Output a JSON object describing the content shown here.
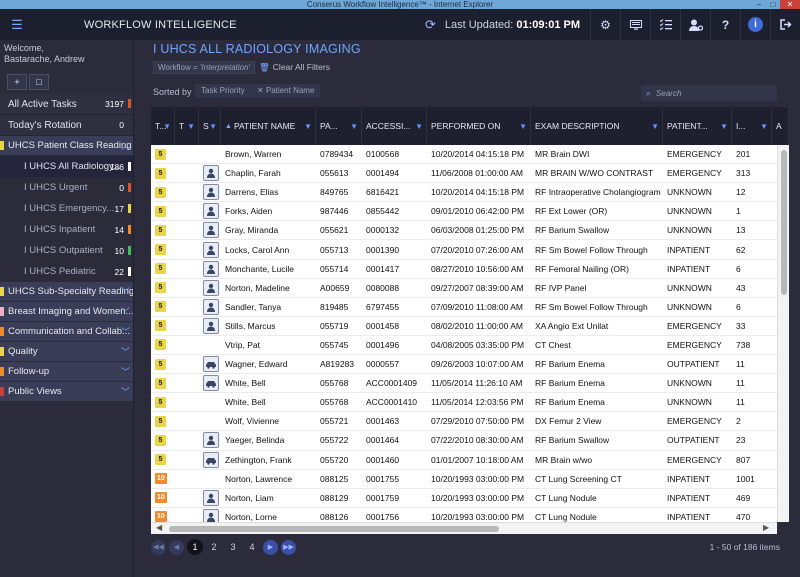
{
  "window": {
    "title": "Conserus Workflow Intelligence™ - Internet Explorer",
    "controls": [
      "–",
      "□",
      "✕"
    ]
  },
  "appbar": {
    "menu_icon": "☰",
    "title": "WORKFLOW INTELLIGENCE",
    "last_updated_label": "Last Updated:",
    "last_updated_time": "01:09:01 PM",
    "icons": [
      "refresh-icon",
      "gear-icon",
      "monitor-icon",
      "checklist-icon",
      "user-settings-icon",
      "help-icon",
      "info-icon",
      "logout-icon"
    ]
  },
  "sidebar": {
    "welcome_line1": "Welcome,",
    "welcome_line2": "Bastarache, Andrew",
    "add_icon": "+",
    "folder_icon": "□",
    "all_active": {
      "label": "All Active Tasks",
      "count": "3197",
      "color": "#d9532a"
    },
    "today": {
      "label": "Today's Rotation",
      "count": "0"
    },
    "groups": [
      {
        "label": "UHCS Patient Class Reading",
        "flag": "#ead54a",
        "expanded": true,
        "items": [
          {
            "label": "I UHCS All Radiology...",
            "count": "186",
            "mark": "#ffffff"
          },
          {
            "label": "I UHCS Urgent",
            "count": "0",
            "mark": "#d9532a"
          },
          {
            "label": "I UHCS Emergency...",
            "count": "17",
            "mark": "#ead54a"
          },
          {
            "label": "I UHCS Inpatient",
            "count": "14",
            "mark": "#f08b2b"
          },
          {
            "label": "I UHCS Outpatient",
            "count": "10",
            "mark": "#3fbf5a"
          },
          {
            "label": "I UHCS Pediatric",
            "count": "22",
            "mark": "#ffffff"
          }
        ]
      },
      {
        "label": "UHCS Sub-Specialty Reading",
        "flag": "#ead54a"
      },
      {
        "label": "Breast Imaging and Women...",
        "flag": "#f2b0c6"
      },
      {
        "label": "Communication and Collab...",
        "flag": "#f08b2b"
      },
      {
        "label": "Quality",
        "flag": "#ead54a"
      },
      {
        "label": "Follow-up",
        "flag": "#f08b2b"
      },
      {
        "label": "Public Views",
        "flag": "#c8423a"
      }
    ]
  },
  "main": {
    "title": "I UHCS ALL RADIOLOGY IMAGING",
    "workflow_chip_prefix": "Workflow = ",
    "workflow_chip_value": "'Interpretation'",
    "clear_filters": "Clear All Filters",
    "sorted_by": "Sorted by",
    "sort_chips": [
      "Task Priority",
      "Patient Name"
    ],
    "sort_chip_remove": "✕",
    "search_placeholder": "Search",
    "columns": [
      "T...",
      "T",
      "S",
      "PATIENT NAME",
      "PA...",
      "ACCESSI...",
      "PERFORMED ON",
      "EXAM DESCRIPTION",
      "PATIENT...",
      "I...",
      "A"
    ],
    "rows": [
      {
        "pri": "5",
        "stat": "",
        "name": "Brown, Warren",
        "pid": "0789434",
        "acc": "0100568",
        "performed": "10/20/2014 04:15:18 PM",
        "exam": "MR Brain DWI",
        "pclass": "EMERGENCY",
        "i": "201"
      },
      {
        "pri": "5",
        "stat": "person",
        "name": "Chaplin, Farah",
        "pid": "055613",
        "acc": "0001494",
        "performed": "11/06/2008 01:00:00 AM",
        "exam": "MR BRAIN W/WO CONTRAST",
        "pclass": "EMERGENCY",
        "i": "313"
      },
      {
        "pri": "5",
        "stat": "person",
        "name": "Darrens, Elias",
        "pid": "849765",
        "acc": "6816421",
        "performed": "10/20/2014 04:15:18 PM",
        "exam": "RF Intraoperative Cholangiogram",
        "pclass": "UNKNOWN",
        "i": "12"
      },
      {
        "pri": "5",
        "stat": "person",
        "name": "Forks, Aiden",
        "pid": "987446",
        "acc": "0855442",
        "performed": "09/01/2010 06:42:00 PM",
        "exam": "RF Ext Lower (OR)",
        "pclass": "UNKNOWN",
        "i": "1"
      },
      {
        "pri": "5",
        "stat": "person",
        "name": "Gray, Miranda",
        "pid": "055621",
        "acc": "0000132",
        "performed": "06/03/2008 01:25:00 PM",
        "exam": "RF Barium Swallow",
        "pclass": "UNKNOWN",
        "i": "13"
      },
      {
        "pri": "5",
        "stat": "person",
        "name": "Locks, Carol Ann",
        "pid": "055713",
        "acc": "0001390",
        "performed": "07/20/2010 07:26:00 AM",
        "exam": "RF Sm Bowel Follow Through",
        "pclass": "INPATIENT",
        "i": "62"
      },
      {
        "pri": "5",
        "stat": "person",
        "name": "Monchante, Lucile",
        "pid": "055714",
        "acc": "0001417",
        "performed": "08/27/2010 10:56:00 AM",
        "exam": "RF Femoral Nailing (OR)",
        "pclass": "INPATIENT",
        "i": "6"
      },
      {
        "pri": "5",
        "stat": "person",
        "name": "Norton, Madeline",
        "pid": "A00659",
        "acc": "0080088",
        "performed": "09/27/2007 08:39:00 AM",
        "exam": "RF IVP Panel",
        "pclass": "UNKNOWN",
        "i": "43"
      },
      {
        "pri": "5",
        "stat": "person",
        "name": "Sandler, Tanya",
        "pid": "819485",
        "acc": "6797455",
        "performed": "07/09/2010 11:08:00 AM",
        "exam": "RF Sm Bowel Follow Through",
        "pclass": "UNKNOWN",
        "i": "6"
      },
      {
        "pri": "5",
        "stat": "person",
        "name": "Stills, Marcus",
        "pid": "055719",
        "acc": "0001458",
        "performed": "08/02/2010 11:00:00 AM",
        "exam": "XA Angio Ext Unilat",
        "pclass": "EMERGENCY",
        "i": "33"
      },
      {
        "pri": "5",
        "stat": "",
        "name": "Vtrip, Pat",
        "pid": "055745",
        "acc": "0001496",
        "performed": "04/08/2005 03:35:00 PM",
        "exam": "CT Chest",
        "pclass": "EMERGENCY",
        "i": "738"
      },
      {
        "pri": "5",
        "stat": "car",
        "name": "Wagner, Edward",
        "pid": "A819283",
        "acc": "0000557",
        "performed": "09/26/2003 10:07:00 AM",
        "exam": "RF Barium Enema",
        "pclass": "OUTPATIENT",
        "i": "11"
      },
      {
        "pri": "5",
        "stat": "car",
        "name": "White, Bell",
        "pid": "055768",
        "acc": "ACC0001409",
        "performed": "11/05/2014 11:26:10 AM",
        "exam": "RF Barium Enema",
        "pclass": "UNKNOWN",
        "i": "11"
      },
      {
        "pri": "5",
        "stat": "",
        "name": "White, Bell",
        "pid": "055768",
        "acc": "ACC0001410",
        "performed": "11/05/2014 12:03:56 PM",
        "exam": "RF Barium Enema",
        "pclass": "UNKNOWN",
        "i": "11"
      },
      {
        "pri": "5",
        "stat": "",
        "name": "Wolf, Vivienne",
        "pid": "055721",
        "acc": "0001463",
        "performed": "07/29/2010 07:50:00 PM",
        "exam": "DX Femur 2 View",
        "pclass": "EMERGENCY",
        "i": "2"
      },
      {
        "pri": "5",
        "stat": "person",
        "name": "Yaeger, Belinda",
        "pid": "055722",
        "acc": "0001464",
        "performed": "07/22/2010 08:30:00 AM",
        "exam": "RF Barium Swallow",
        "pclass": "OUTPATIENT",
        "i": "23"
      },
      {
        "pri": "5",
        "stat": "car",
        "name": "Zethington, Frank",
        "pid": "055720",
        "acc": "0001460",
        "performed": "01/01/2007 10:18:00 AM",
        "exam": "MR Brain w/wo",
        "pclass": "EMERGENCY",
        "i": "807"
      },
      {
        "pri": "10",
        "stat": "",
        "name": "Norton, Lawrence",
        "pid": "088125",
        "acc": "0001755",
        "performed": "10/20/1993 03:00:00 PM",
        "exam": "CT Lung Screening CT",
        "pclass": "INPATIENT",
        "i": "1001"
      },
      {
        "pri": "10",
        "stat": "person",
        "name": "Norton, Liam",
        "pid": "088129",
        "acc": "0001759",
        "performed": "10/20/1993 03:00:00 PM",
        "exam": "CT Lung Nodule",
        "pclass": "INPATIENT",
        "i": "469"
      },
      {
        "pri": "10",
        "stat": "person",
        "name": "Norton, Lorne",
        "pid": "088126",
        "acc": "0001756",
        "performed": "10/20/1993 03:00:00 PM",
        "exam": "CT Lung Nodule",
        "pclass": "INPATIENT",
        "i": "470"
      }
    ],
    "pager": {
      "first": "◀◀",
      "prev": "◀",
      "next": "▶",
      "last": "▶▶",
      "pages": [
        "1",
        "2",
        "3",
        "4"
      ],
      "current": "1",
      "info": "1 - 50 of 186 items"
    }
  }
}
